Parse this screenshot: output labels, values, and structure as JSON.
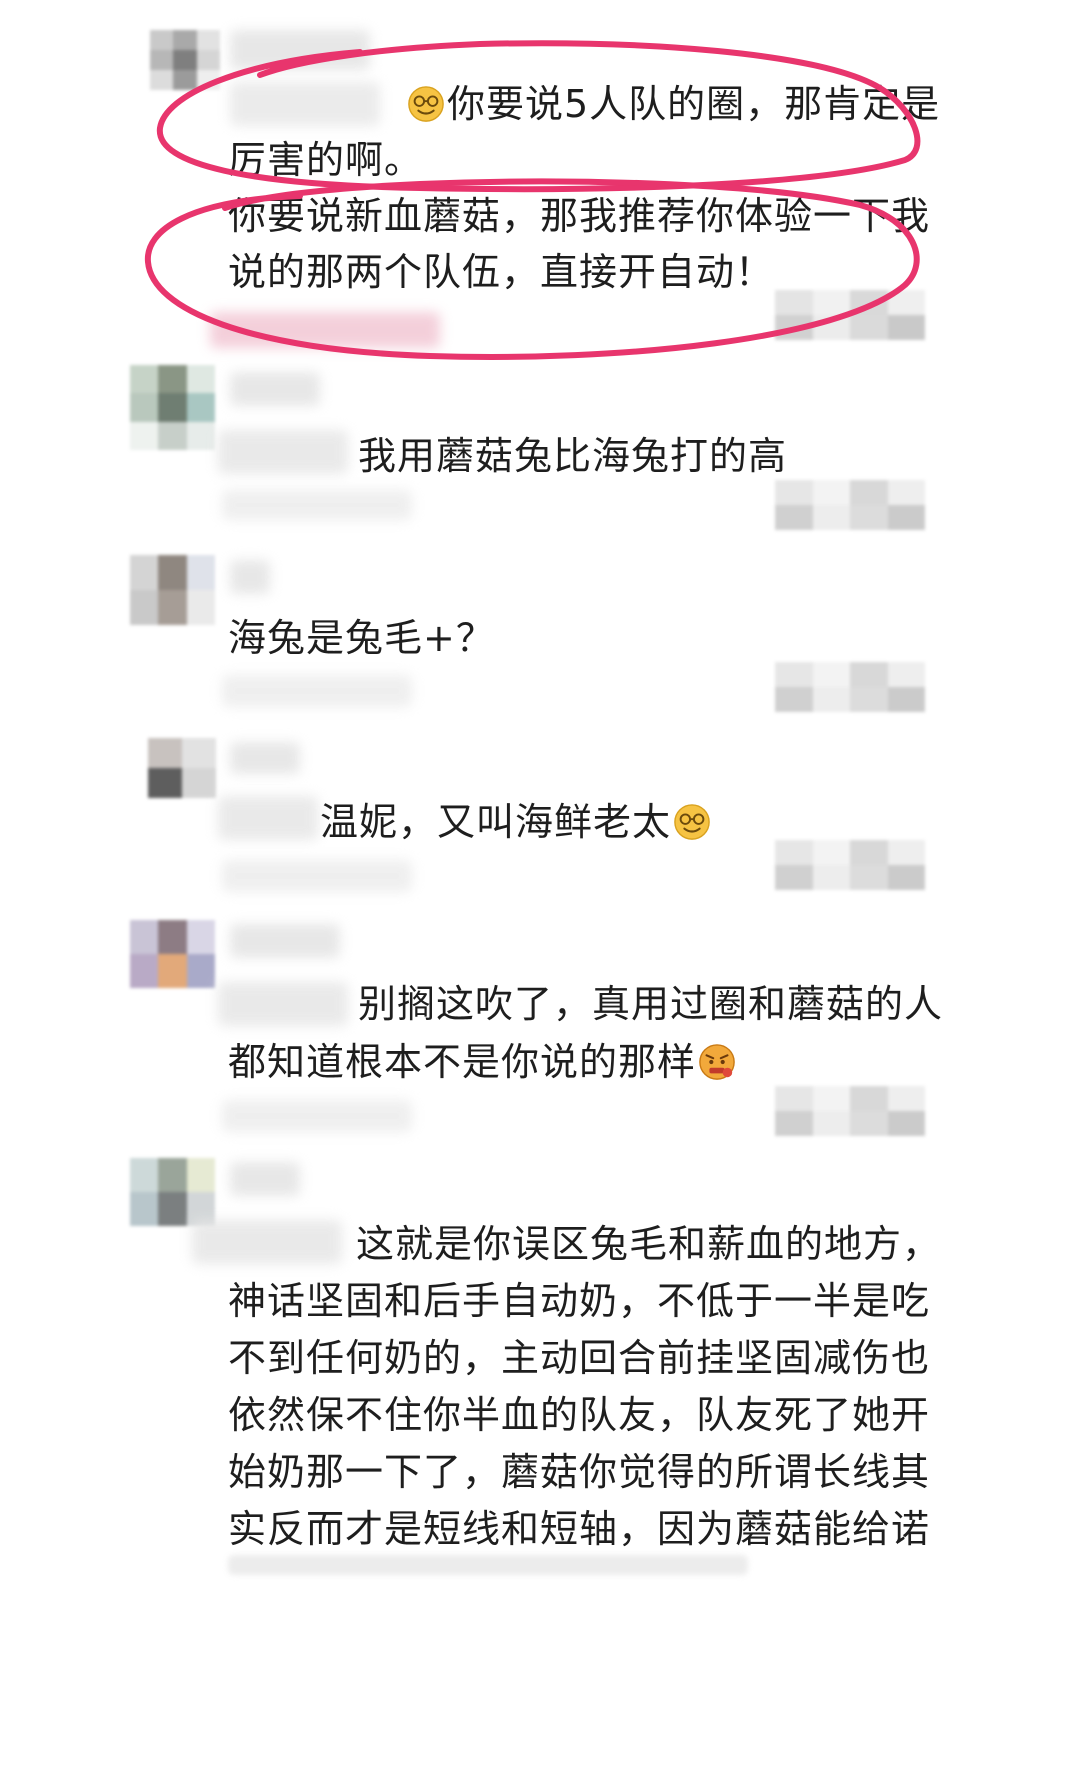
{
  "comments": [
    {
      "id": "c1",
      "lines": [
        "你要说5人队的圈，那肯定是",
        "厉害的啊。",
        "你要说新血蘑菇，那我推荐你体验一下我",
        "说的那两个队伍，直接开自动！"
      ]
    },
    {
      "id": "c2",
      "lines": [
        "我用蘑菇兔比海兔打的高"
      ]
    },
    {
      "id": "c3",
      "lines": [
        "海兔是兔毛+？"
      ]
    },
    {
      "id": "c4",
      "lines": [
        "温妮，又叫海鲜老太"
      ]
    },
    {
      "id": "c5",
      "lines": [
        "别搁这吹了，真用过圈和蘑菇的人",
        "都知道根本不是你说的那样"
      ]
    },
    {
      "id": "c6",
      "lines": [
        "这就是你误区兔毛和薪血的地方，",
        "神话坚固和后手自动奶，不低于一半是吃",
        "不到任何奶的，主动回合前挂坚固减伤也",
        "依然保不住你半血的队友，队友死了她开",
        "始奶那一下了，蘑菇你觉得的所谓长线其",
        "实反而才是短线和短轴，因为蘑菇能给诺"
      ]
    }
  ],
  "emoji_names": [
    "smile-glasses-emoji",
    "smile-glasses-emoji",
    "angry-face-emoji"
  ],
  "colors": {
    "annotation": "#e8356d",
    "text": "#1e1e1e",
    "background": "#ffffff"
  }
}
